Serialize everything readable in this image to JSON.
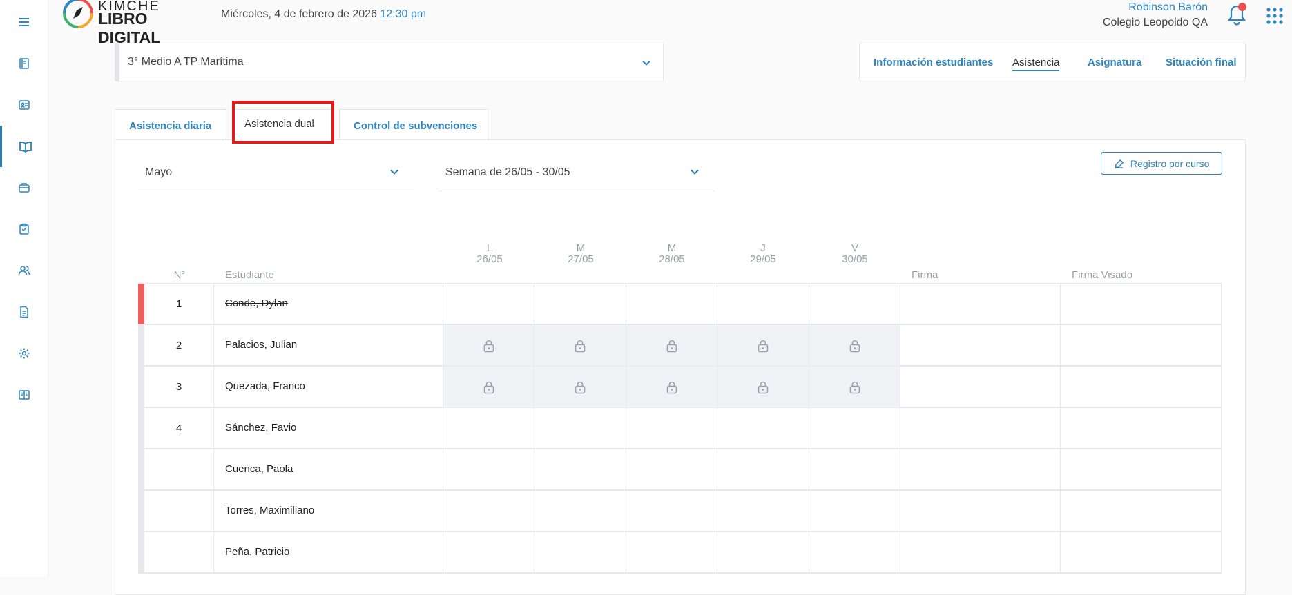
{
  "header": {
    "logo_top": "KIMCHE",
    "logo_bottom": "LIBRO DIGITAL",
    "date": "Miércoles, 4 de febrero de 2026",
    "time": "12:30 pm",
    "user_name": "Robinson Barón",
    "school": "Colegio Leopoldo QA"
  },
  "course_select": {
    "value": "3° Medio A TP Marítima"
  },
  "nav": [
    "Información estudiantes",
    "Asistencia",
    "Asignatura",
    "Situación final"
  ],
  "nav_active": "Asistencia",
  "tabs": [
    "Asistencia diaria",
    "Asistencia dual",
    "Control de subvenciones"
  ],
  "tab_active": "Asistencia dual",
  "filters": {
    "month": "Mayo",
    "week": "Semana de 26/05 - 30/05"
  },
  "register_button": "Registro por curso",
  "table": {
    "col_num": "N°",
    "col_student": "Estudiante",
    "days": [
      {
        "letter": "L",
        "date": "26/05"
      },
      {
        "letter": "M",
        "date": "27/05"
      },
      {
        "letter": "M",
        "date": "28/05"
      },
      {
        "letter": "J",
        "date": "29/05"
      },
      {
        "letter": "V",
        "date": "30/05"
      }
    ],
    "col_firma": "Firma",
    "col_firma_visado": "Firma Visado",
    "rows": [
      {
        "num": "1",
        "name": "Conde, Dylan",
        "withdrawn": true,
        "locked": false
      },
      {
        "num": "2",
        "name": "Palacios, Julian",
        "withdrawn": false,
        "locked": true
      },
      {
        "num": "3",
        "name": "Quezada, Franco",
        "withdrawn": false,
        "locked": true
      },
      {
        "num": "4",
        "name": "Sánchez, Favio",
        "withdrawn": false,
        "locked": false
      },
      {
        "num": "",
        "name": "Cuenca, Paola",
        "withdrawn": false,
        "locked": false
      },
      {
        "num": "",
        "name": "Torres, Maximiliano",
        "withdrawn": false,
        "locked": false
      },
      {
        "num": "",
        "name": "Peña, Patricio",
        "withdrawn": false,
        "locked": false
      }
    ]
  },
  "colors": {
    "accent": "#2f86c0",
    "highlight": "#e21c1c",
    "withdrawn": "#ef5e5e",
    "notification": "#ef4e4e"
  },
  "sidebar_icons": [
    "menu-icon",
    "notebook-icon",
    "id-card-icon",
    "book-open-icon",
    "briefcase-icon",
    "clipboard-icon",
    "users-icon",
    "document-icon",
    "gear-icon",
    "book-icon"
  ]
}
